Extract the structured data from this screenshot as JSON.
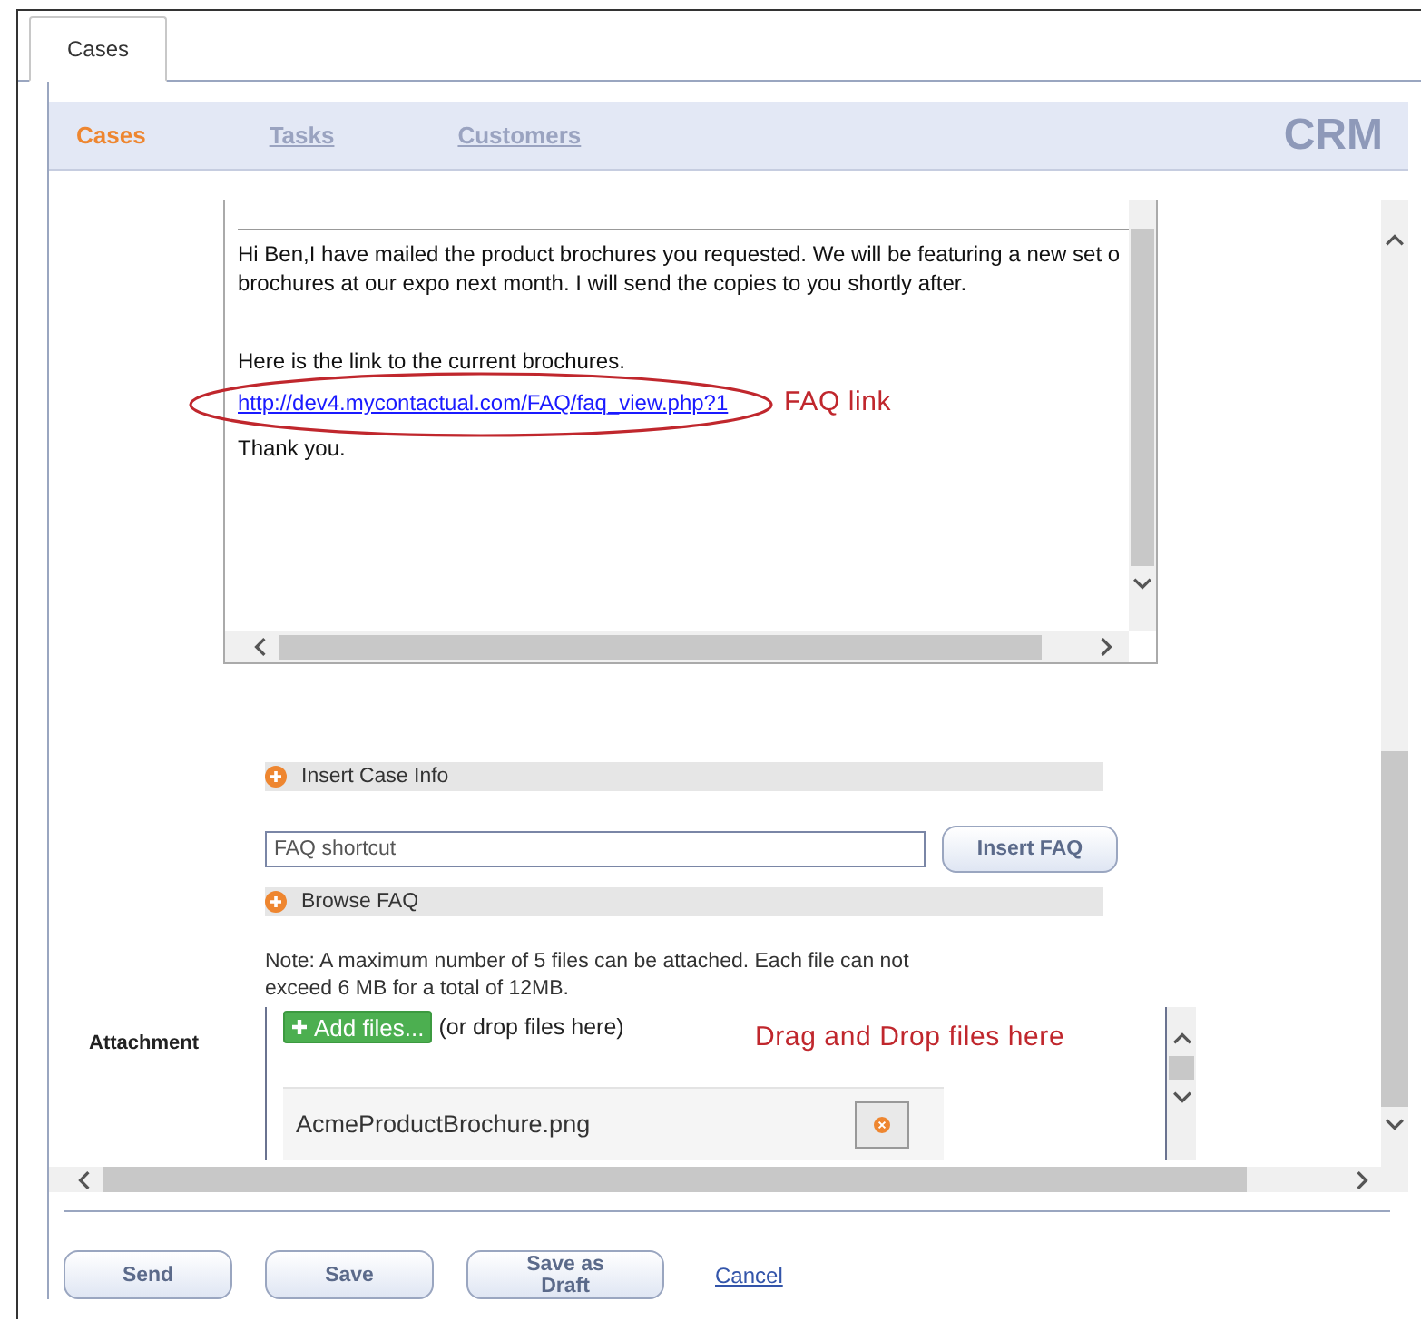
{
  "tabs": [
    {
      "label": "Cases",
      "selected": true
    }
  ],
  "nav": {
    "items": [
      {
        "label": "Cases",
        "selected": true
      },
      {
        "label": "Tasks",
        "selected": false
      },
      {
        "label": "Customers",
        "selected": false
      }
    ],
    "brand": "CRM"
  },
  "email": {
    "lines": [
      "Hi Ben,I have mailed the product brochures you requested. We will be featuring a new set o",
      "brochures at our expo next month. I will send the copies to you shortly after."
    ],
    "link_intro": "Here is the link to the current brochures.",
    "link": "http://dev4.mycontactual.com/FAQ/faq_view.php?1",
    "closing": "Thank you."
  },
  "annotations": [
    {
      "kind": "ellipse",
      "text": "FAQ link"
    },
    {
      "kind": "plain",
      "text": "Drag and Drop files here"
    }
  ],
  "insert_case_info": "Insert Case Info",
  "faq_field": {
    "placeholder": "FAQ shortcut",
    "button": "Insert FAQ"
  },
  "browse_faq": "Browse FAQ",
  "note": "Note: A maximum number of 5 files can be attached. Each file can not exceed 6 MB for a total of 12MB.",
  "attachment": {
    "label": "Attachment",
    "add_button": "Add files...",
    "hint": "(or drop files here)",
    "files": [
      {
        "name": "AcmeProductBrochure.png"
      }
    ]
  },
  "actions": [
    {
      "kind": "button",
      "label": "Send"
    },
    {
      "kind": "button",
      "label": "Save"
    },
    {
      "kind": "button",
      "label": "Save as Draft"
    },
    {
      "kind": "link",
      "label": "Cancel"
    }
  ]
}
